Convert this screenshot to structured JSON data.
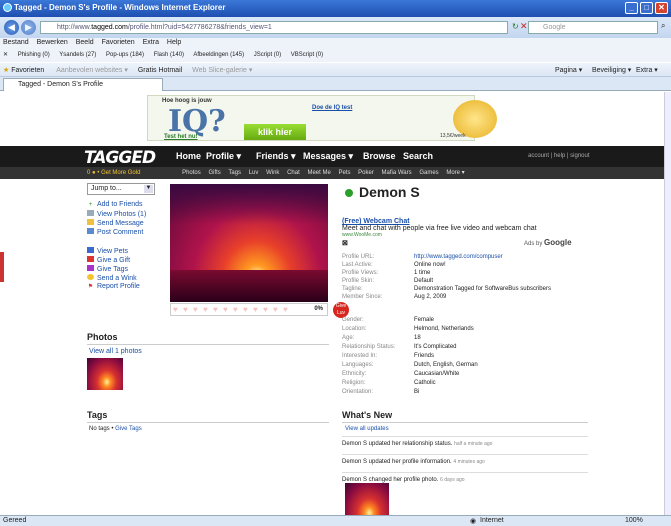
{
  "window": {
    "title": "Tagged - Demon S's Profile - Windows Internet Explorer"
  },
  "browser": {
    "url_prefix": "http://www.",
    "url_domain": "tagged.com",
    "url_rest": "/profile.html?uid=5427786278&friends_view=1",
    "search_placeholder": "Google",
    "menu": [
      "Bestand",
      "Bewerken",
      "Beeld",
      "Favorieten",
      "Extra",
      "Help"
    ],
    "links": [
      "Phishing (0)",
      "Ysandels (27)",
      "Pop-ups (184)",
      "Flash (140)",
      "Afbeeldingen (145)",
      "JScript (0)",
      "VBScript (0)"
    ],
    "fav_label": "Favorieten",
    "fav_items": [
      "Aanbevolen websites ▾",
      "Gratis Hotmail",
      "Web Slice-galerie ▾"
    ],
    "cmd_items": [
      "Pagina ▾",
      "Beveiliging ▾",
      "Extra ▾"
    ],
    "tab_title": "Tagged - Demon S's Profile",
    "status_left": "Gereed",
    "status_zone": "Internet",
    "status_zoom": "100%"
  },
  "ad": {
    "top": "Hoe hoog is jouw",
    "big": "IQ?",
    "cta": "Test het nu!",
    "mid": "Doe de IQ test",
    "button": "klik hier",
    "price": "13,5€/week"
  },
  "nav": {
    "logo": "TAGGED",
    "items": [
      "Home",
      "Profile ▾",
      "Friends ▾",
      "Messages ▾",
      "Browse",
      "Search"
    ],
    "account": "account | help | signout",
    "gold": "0 ● • Get More Gold",
    "sub": [
      "Photos",
      "Gifts",
      "Tags",
      "Luv",
      "Wink",
      "Chat",
      "Meet Me",
      "Pets",
      "Poker",
      "Mafia Wars",
      "Games",
      "More ▾"
    ]
  },
  "jump": {
    "label": "Jump to..."
  },
  "actions": [
    "Add to Friends",
    "View Photos (1)",
    "Send Message",
    "Post Comment"
  ],
  "actions2": [
    "View Pets",
    "Give a Gift",
    "Give Tags",
    "Send a Wink",
    "Report Profile"
  ],
  "rating": {
    "percent": "0%",
    "luv_label": "Give Luv"
  },
  "profile": {
    "name": "Demon S",
    "ad_title": "(Free) Webcam Chat",
    "ad_text": "Meet and chat with people via free live video and webcam chat",
    "ad_url": "www.WooMe.com",
    "ads_by": "Ads by",
    "ads_by_brand": "Google",
    "fields": [
      [
        "Profile URL:",
        "http://www.tagged.com/compuser"
      ],
      [
        "Last Active:",
        "Online now!"
      ],
      [
        "Profile Views:",
        "1 time"
      ],
      [
        "Profile Skin:",
        "Default"
      ],
      [
        "Tagline:",
        "Demonstration Tagged for SoftwareBus subscribers"
      ],
      [
        "Member Since:",
        "Aug 2, 2009"
      ]
    ],
    "fields2": [
      [
        "Gender:",
        "Female"
      ],
      [
        "Location:",
        "Helmond, Netherlands"
      ],
      [
        "Age:",
        "18"
      ],
      [
        "Relationship Status:",
        "It's Complicated"
      ],
      [
        "Interested In:",
        "Friends"
      ],
      [
        "Languages:",
        "Dutch, English, German"
      ],
      [
        "Ethnicity:",
        "Caucasian/White"
      ],
      [
        "Religion:",
        "Catholic"
      ],
      [
        "Orientation:",
        "Bi"
      ]
    ]
  },
  "photos": {
    "title": "Photos",
    "link": "View all 1 photos"
  },
  "tags": {
    "title": "Tags",
    "text": "No tags •",
    "link": "Give Tags"
  },
  "whatsnew": {
    "title": "What's New",
    "link": "View all updates",
    "items": [
      {
        "text": "Demon S updated her relationship status.",
        "time": "half a minute ago"
      },
      {
        "text": "Demon S updated her profile information.",
        "time": "4 minutes ago"
      },
      {
        "text": "Demon S changed her profile photo.",
        "time": "6 days ago"
      }
    ]
  }
}
